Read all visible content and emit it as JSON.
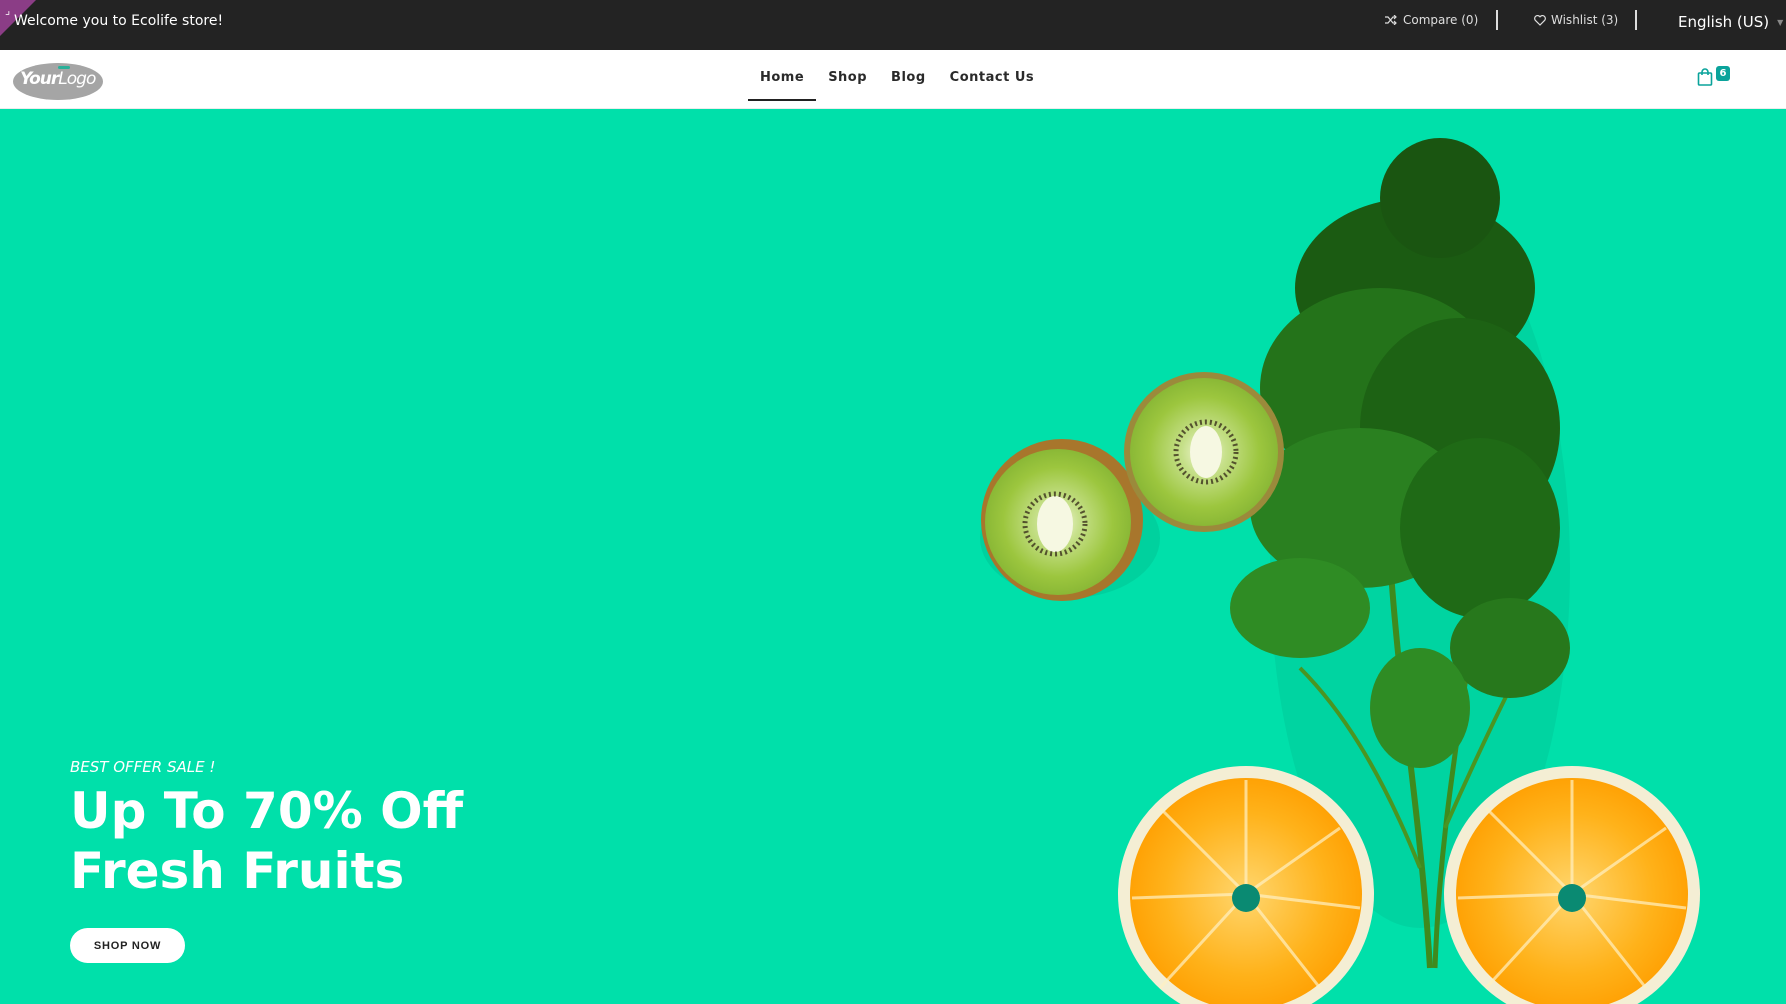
{
  "topbar": {
    "welcome": "Welcome you to Ecolife store!",
    "compare": "Compare (0)",
    "wishlist": "Wishlist (3)",
    "language": "English (US)"
  },
  "header": {
    "logo": {
      "text_bold": "Your",
      "text_regular": "Logo"
    },
    "nav": [
      "Home",
      "Shop",
      "Blog",
      "Contact Us"
    ],
    "active_nav": "Home",
    "cart_count": "6"
  },
  "hero": {
    "subtitle": "BEST OFFER SALE !",
    "title_line1": "Up To 70% Off",
    "title_line2": "Fresh Fruits",
    "cta": "SHOP NOW",
    "background_color": "#00e0aa"
  },
  "colors": {
    "topbar": "#232323",
    "accent": "#0aa39b",
    "hero_bg": "#00e0aa"
  }
}
